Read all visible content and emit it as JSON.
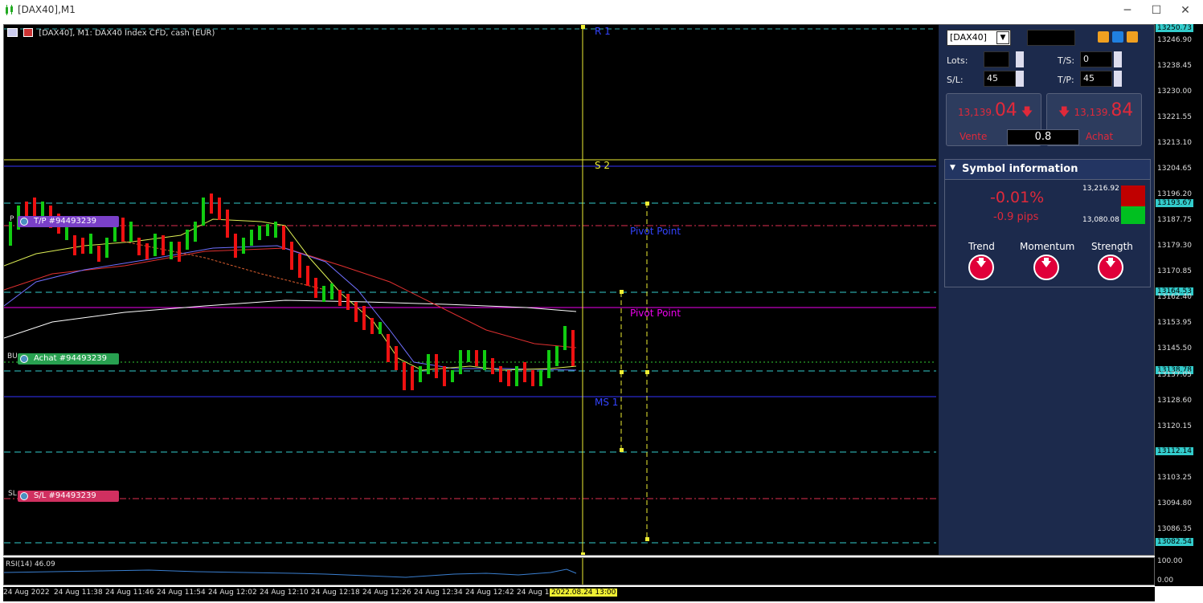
{
  "window": {
    "title": "[DAX40],M1"
  },
  "chart": {
    "header": "[DAX40], M1:  DAX40 Index CFD, cash (EUR)",
    "rsi_label": "RSI(14) 46.09",
    "rsi_ticks": [
      "100.00",
      "0.00"
    ],
    "levels": {
      "r1": "R 1",
      "s2": "S 2",
      "pivot_blue": "Pivot Point",
      "pivot_magenta": "Pivot Point",
      "ms1": "MS 1"
    },
    "trades": {
      "tp": {
        "label": "T/P #94493239",
        "side": "P"
      },
      "buy": {
        "label": "Achat #94493239",
        "side": "BU"
      },
      "sl": {
        "label": "S/L #94493239",
        "side": "SL"
      }
    },
    "price_ticks": [
      "13246.90",
      "13238.45",
      "13230.00",
      "13221.55",
      "13213.10",
      "13204.65",
      "13196.20",
      "13187.75",
      "13179.30",
      "13170.85",
      "13162.40",
      "13153.95",
      "13145.50",
      "13137.05",
      "13128.60",
      "13120.15",
      "13103.25",
      "13094.80",
      "13086.35"
    ],
    "price_tags": {
      "top": "13250.73",
      "t1": "13193.67",
      "t2": "13164.53",
      "t3": "13138.78",
      "t4": "13112.14",
      "t5": "13082.54"
    },
    "time_labels": [
      "24 Aug 2022",
      "24 Aug 11:38",
      "24 Aug 11:46",
      "24 Aug 11:54",
      "24 Aug 12:02",
      "24 Aug 12:10",
      "24 Aug 12:18",
      "24 Aug 12:26",
      "24 Aug 12:34",
      "24 Aug 12:42",
      "24 Aug 12"
    ],
    "time_marker": "2022.08.24 13:00"
  },
  "panel": {
    "symbol": "[DAX40]",
    "lots_label": "Lots:",
    "lots_value": "",
    "ts_label": "T/S:",
    "ts_value": "0",
    "sl_label": "S/L:",
    "sl_value": "45",
    "tp_label": "T/P:",
    "tp_value": "45",
    "sell": {
      "prefix": "13,139.",
      "big": "04",
      "label": "Vente"
    },
    "buy": {
      "prefix": "13,139.",
      "big": "84",
      "label": "Achat"
    },
    "spread": "0.8",
    "info_title": "Symbol information",
    "change_pct": "-0.01%",
    "change_pips": "-0.9 pips",
    "high": "13,216.92",
    "low": "13,080.08",
    "indicators": [
      "Trend",
      "Momentum",
      "Strength"
    ],
    "colors": {
      "accent_red": "#e0293a",
      "panel_bg": "#1c2a4c",
      "high_box": "#c00000",
      "low_box": "#00c020"
    }
  }
}
